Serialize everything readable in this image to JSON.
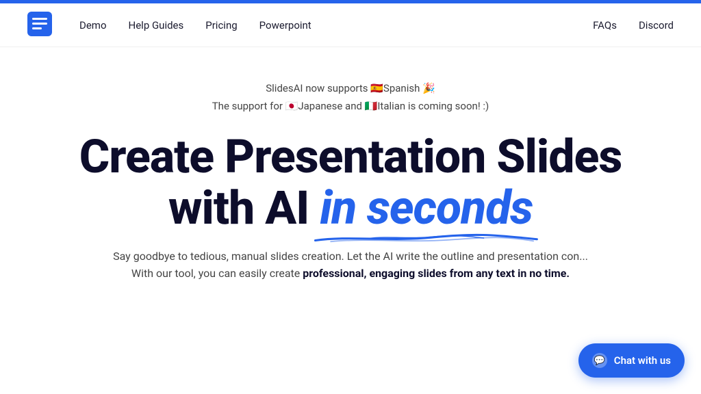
{
  "topbar": {
    "color": "#2563eb"
  },
  "nav": {
    "logo_alt": "SlidesAI Logo",
    "links_left": [
      {
        "label": "Demo",
        "id": "demo"
      },
      {
        "label": "Help Guides",
        "id": "help-guides"
      },
      {
        "label": "Pricing",
        "id": "pricing"
      },
      {
        "label": "Powerpoint",
        "id": "powerpoint"
      }
    ],
    "links_right": [
      {
        "label": "FAQs",
        "id": "faqs"
      },
      {
        "label": "Discord",
        "id": "discord"
      }
    ]
  },
  "hero": {
    "announcement_line1": "SlidesAI now supports 🇪🇸Spanish 🎉",
    "announcement_line2": "The support for 🇯🇵Japanese and 🇮🇹Italian is coming soon! :)",
    "title_part1": "Create Presentation Slides",
    "title_part2": "with AI ",
    "title_highlight": "in seconds",
    "subtitle_part1": "Say goodbye to tedious, manual slides creation. Let the AI write the outline and presentation con",
    "subtitle_part2": "With our tool, you can easily create ",
    "subtitle_bold": "professional, engaging slides from any text in no time."
  },
  "chat_widget": {
    "label": "Chat with us",
    "icon": "💬"
  }
}
